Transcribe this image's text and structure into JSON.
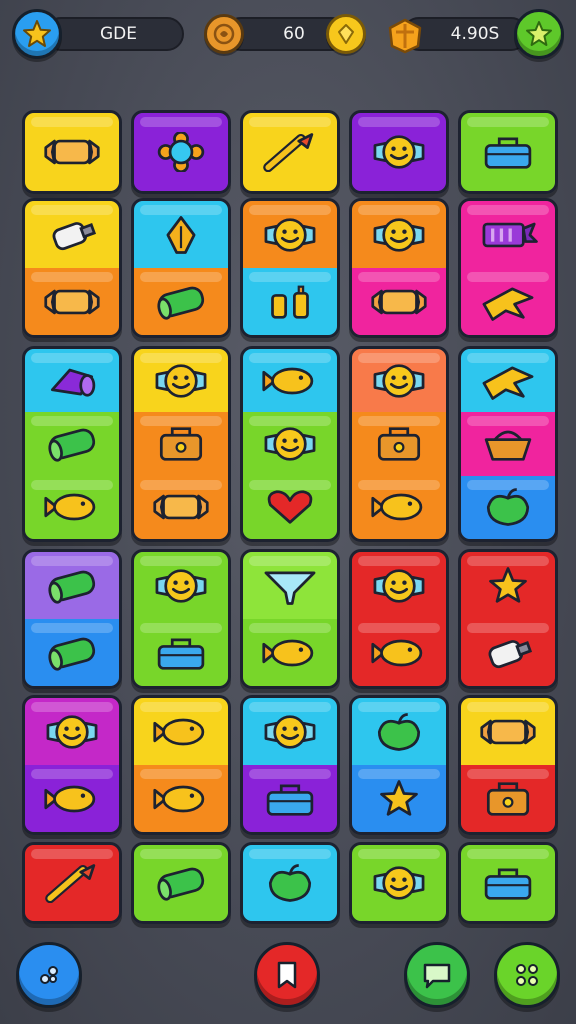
{
  "hud": {
    "left_label": "GDE",
    "coins_value": "60",
    "score_value": "4.90S"
  },
  "colors": {
    "yellow": "#f8d41c",
    "purple": "#8a22d8",
    "green": "#78d62a",
    "cyan": "#2ec6ee",
    "orange": "#f58a1c",
    "pink": "#f0249e",
    "red": "#e42828",
    "lavender": "#9a6ae6",
    "blue": "#2a8ef0",
    "magenta": "#c428c8",
    "salmon": "#f87a4a",
    "light_green": "#8ee43a"
  },
  "board": {
    "rows": 6,
    "columns": 5,
    "tiles": [
      {
        "row": 0,
        "col": 0,
        "segments": [
          {
            "color": "yellow",
            "icon": "candy-wrapper-icon"
          }
        ]
      },
      {
        "row": 0,
        "col": 1,
        "segments": [
          {
            "color": "purple",
            "icon": "flower-gem-icon"
          }
        ]
      },
      {
        "row": 0,
        "col": 2,
        "segments": [
          {
            "color": "yellow",
            "icon": "brush-icon"
          }
        ]
      },
      {
        "row": 0,
        "col": 3,
        "segments": [
          {
            "color": "purple",
            "icon": "face-candy-icon"
          }
        ]
      },
      {
        "row": 0,
        "col": 4,
        "segments": [
          {
            "color": "green",
            "icon": "toolbox-icon"
          }
        ]
      },
      {
        "row": 1,
        "col": 0,
        "segments": [
          {
            "color": "yellow",
            "icon": "tube-icon"
          },
          {
            "color": "orange",
            "icon": "candy-wrapper-icon"
          }
        ]
      },
      {
        "row": 1,
        "col": 1,
        "segments": [
          {
            "color": "cyan",
            "icon": "leaf-icon"
          },
          {
            "color": "orange",
            "icon": "roll-icon"
          }
        ]
      },
      {
        "row": 1,
        "col": 2,
        "segments": [
          {
            "color": "orange",
            "icon": "face-candy-icon"
          },
          {
            "color": "cyan",
            "icon": "bottles-icon"
          }
        ]
      },
      {
        "row": 1,
        "col": 3,
        "segments": [
          {
            "color": "orange",
            "icon": "face-candy-icon"
          },
          {
            "color": "pink",
            "icon": "candy-wrapper-icon"
          }
        ]
      },
      {
        "row": 1,
        "col": 4,
        "segments": [
          {
            "color": "pink",
            "icon": "battery-icon"
          },
          {
            "color": "pink",
            "icon": "star-bird-icon"
          }
        ]
      },
      {
        "row": 2,
        "col": 0,
        "segments": [
          {
            "color": "cyan",
            "icon": "cannon-icon"
          },
          {
            "color": "green",
            "icon": "roll-icon"
          },
          {
            "color": "green",
            "icon": "fish-icon"
          }
        ]
      },
      {
        "row": 2,
        "col": 1,
        "segments": [
          {
            "color": "yellow",
            "icon": "face-candy-icon"
          },
          {
            "color": "orange",
            "icon": "bag-icon"
          },
          {
            "color": "orange",
            "icon": "candy-wrapper-icon"
          }
        ]
      },
      {
        "row": 2,
        "col": 2,
        "segments": [
          {
            "color": "cyan",
            "icon": "fish-icon"
          },
          {
            "color": "green",
            "icon": "face-candy-icon"
          },
          {
            "color": "green",
            "icon": "heart-icon"
          }
        ]
      },
      {
        "row": 2,
        "col": 3,
        "segments": [
          {
            "color": "salmon",
            "icon": "face-candy-icon"
          },
          {
            "color": "orange",
            "icon": "bag-icon"
          },
          {
            "color": "orange",
            "icon": "fish-icon"
          }
        ]
      },
      {
        "row": 2,
        "col": 4,
        "segments": [
          {
            "color": "cyan",
            "icon": "star-bird-icon"
          },
          {
            "color": "pink",
            "icon": "basket-icon"
          },
          {
            "color": "blue",
            "icon": "apple-icon"
          }
        ]
      },
      {
        "row": 3,
        "col": 0,
        "segments": [
          {
            "color": "lavender",
            "icon": "roll-icon"
          },
          {
            "color": "blue",
            "icon": "roll-icon"
          }
        ]
      },
      {
        "row": 3,
        "col": 1,
        "segments": [
          {
            "color": "green",
            "icon": "face-candy-icon"
          },
          {
            "color": "green",
            "icon": "toolbox-icon"
          }
        ]
      },
      {
        "row": 3,
        "col": 2,
        "segments": [
          {
            "color": "light_green",
            "icon": "funnel-icon"
          },
          {
            "color": "green",
            "icon": "fish-icon"
          }
        ]
      },
      {
        "row": 3,
        "col": 3,
        "segments": [
          {
            "color": "red",
            "icon": "face-candy-icon"
          },
          {
            "color": "red",
            "icon": "fish-icon"
          }
        ]
      },
      {
        "row": 3,
        "col": 4,
        "segments": [
          {
            "color": "red",
            "icon": "star-icon"
          },
          {
            "color": "red",
            "icon": "tube-icon"
          }
        ]
      },
      {
        "row": 4,
        "col": 0,
        "segments": [
          {
            "color": "magenta",
            "icon": "face-candy-icon"
          },
          {
            "color": "purple",
            "icon": "fish-icon"
          }
        ]
      },
      {
        "row": 4,
        "col": 1,
        "segments": [
          {
            "color": "yellow",
            "icon": "fish-icon"
          },
          {
            "color": "orange",
            "icon": "fish-icon"
          }
        ]
      },
      {
        "row": 4,
        "col": 2,
        "segments": [
          {
            "color": "cyan",
            "icon": "face-candy-icon"
          },
          {
            "color": "purple",
            "icon": "toolbox-icon"
          }
        ]
      },
      {
        "row": 4,
        "col": 3,
        "segments": [
          {
            "color": "cyan",
            "icon": "apple-icon"
          },
          {
            "color": "blue",
            "icon": "star-icon"
          }
        ]
      },
      {
        "row": 4,
        "col": 4,
        "segments": [
          {
            "color": "yellow",
            "icon": "candy-wrapper-icon"
          },
          {
            "color": "red",
            "icon": "bag-icon"
          }
        ]
      },
      {
        "row": 5,
        "col": 0,
        "segments": [
          {
            "color": "red",
            "icon": "brush-icon"
          }
        ]
      },
      {
        "row": 5,
        "col": 1,
        "segments": [
          {
            "color": "green",
            "icon": "roll-icon"
          }
        ]
      },
      {
        "row": 5,
        "col": 2,
        "segments": [
          {
            "color": "cyan",
            "icon": "apple-icon"
          }
        ]
      },
      {
        "row": 5,
        "col": 3,
        "segments": [
          {
            "color": "green",
            "icon": "face-candy-icon"
          }
        ]
      },
      {
        "row": 5,
        "col": 4,
        "segments": [
          {
            "color": "green",
            "icon": "toolbox-icon"
          }
        ]
      }
    ]
  },
  "bottom_bar": {
    "buttons": [
      {
        "name": "shuffle-button",
        "icon": "dots-icon",
        "color": "#2a8ef0"
      },
      {
        "name": "bookmark-button",
        "icon": "bookmark-icon",
        "color": "#e42828"
      },
      {
        "name": "chat-button",
        "icon": "chat-icon",
        "color": "#3cc24a"
      },
      {
        "name": "menu-button",
        "icon": "grid-dots-icon",
        "color": "#6ad42a"
      }
    ]
  }
}
